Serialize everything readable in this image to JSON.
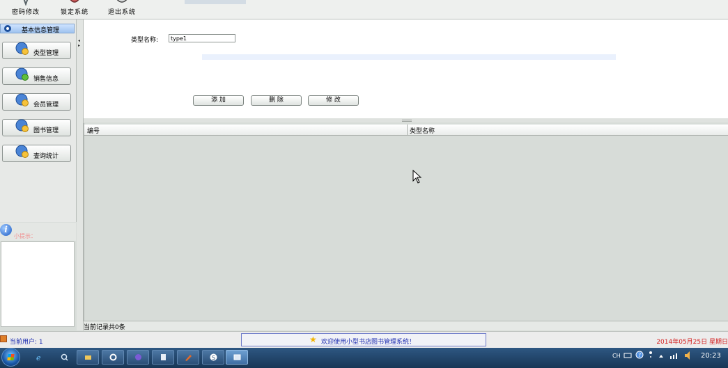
{
  "toolbar": {
    "buttons": [
      {
        "label": "密码修改",
        "icon": "key-icon"
      },
      {
        "label": "锁定系统",
        "icon": "lock-icon"
      },
      {
        "label": "退出系统",
        "icon": "exit-icon"
      }
    ]
  },
  "sidebar": {
    "header": "基本信息管理",
    "items": [
      {
        "label": "类型管理"
      },
      {
        "label": "销售信息"
      },
      {
        "label": "会员管理"
      },
      {
        "label": "图书管理"
      },
      {
        "label": "查询统计"
      }
    ],
    "tip_label": "小提示：",
    "tip_content": ""
  },
  "form": {
    "type_name_label": "类型名称:",
    "type_name_value": "type1",
    "add_label": "添 加",
    "delete_label": "删 除",
    "edit_label": "修 改"
  },
  "grid": {
    "columns": [
      "编号",
      "类型名称"
    ],
    "rows": [],
    "record_count_text": "当前记录共0条"
  },
  "status": {
    "user_label": "当前用户: 1",
    "welcome": "欢迎使用小型书店图书管理系统！",
    "datetime": "2014年05月25日 星期日"
  },
  "taskbar": {
    "apps": [
      "ie-icon",
      "search-icon",
      "folder-icon",
      "settings-icon",
      "media-icon",
      "document-icon",
      "pen-icon",
      "sogou-icon",
      "java-app-icon"
    ],
    "tray_lang": "CH",
    "clock": "20:23"
  }
}
